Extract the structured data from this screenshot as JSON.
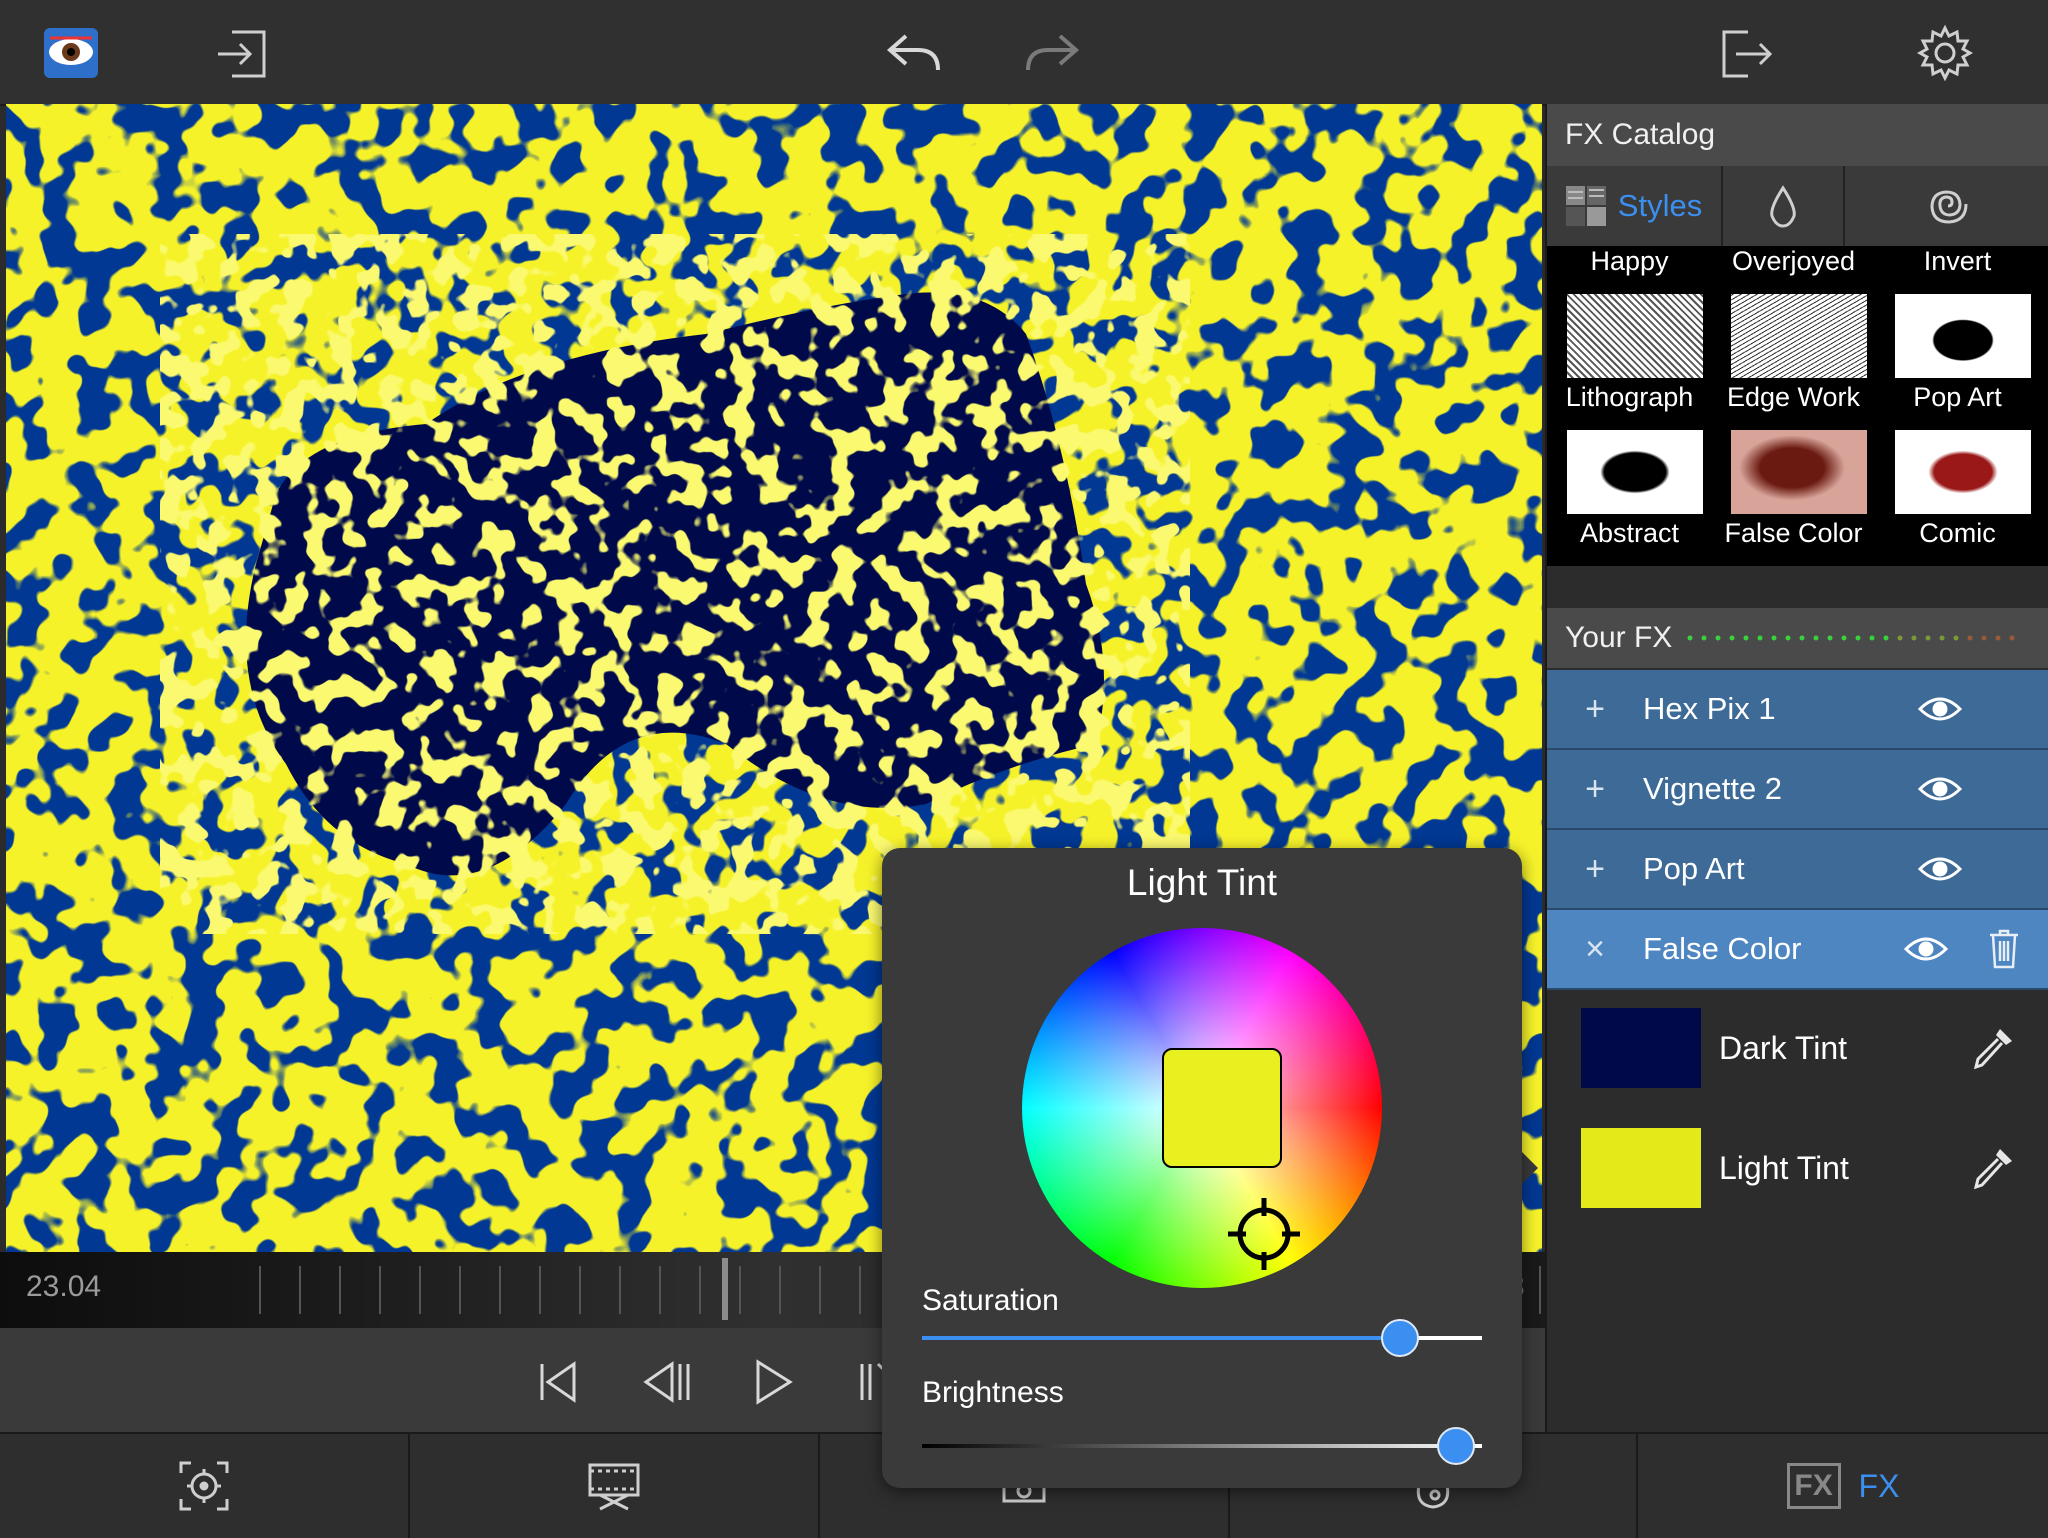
{
  "toolbar": {
    "app_icon": "eye-logo-icon",
    "import_icon": "import-icon",
    "undo_icon": "undo-icon",
    "redo_icon": "redo-icon",
    "export_icon": "export-icon",
    "settings_icon": "gear-icon"
  },
  "timeline": {
    "time": "23.04",
    "end_partial": "3"
  },
  "transport": {
    "buttons": [
      "skip-to-start-icon",
      "step-back-icon",
      "play-icon",
      "step-forward-icon"
    ]
  },
  "fx_catalog": {
    "title": "FX Catalog",
    "tabs": [
      {
        "label": "Styles",
        "icon": "styles-grid-icon",
        "active": true
      },
      {
        "label": "",
        "icon": "drop-icon"
      },
      {
        "label": "",
        "icon": "spiral-icon"
      }
    ],
    "rows": [
      [
        "Happy",
        "Overjoyed",
        "Invert"
      ],
      [
        "Lithograph",
        "Edge Work",
        "Pop Art"
      ],
      [
        "Abstract",
        "False Color",
        "Comic"
      ]
    ]
  },
  "your_fx": {
    "title": "Your FX",
    "items": [
      {
        "name": "Hex Pix 1",
        "symbol": "+",
        "visible": true
      },
      {
        "name": "Vignette 2",
        "symbol": "+",
        "visible": true
      },
      {
        "name": "Pop Art",
        "symbol": "+",
        "visible": true
      },
      {
        "name": "False Color",
        "symbol": "×",
        "visible": true,
        "selected": true
      }
    ]
  },
  "tints": [
    {
      "name": "Dark Tint",
      "color": "#000a4a"
    },
    {
      "name": "Light Tint",
      "color": "#e2ea1a"
    }
  ],
  "popup": {
    "title": "Light Tint",
    "current_color": "#e8f020",
    "saturation_label": "Saturation",
    "saturation": 0.85,
    "brightness_label": "Brightness",
    "brightness": 0.95
  },
  "bottom_bar": {
    "items": [
      "focus-target-icon",
      "film-cut-icon",
      "person-icon",
      "palette-icon",
      "FX"
    ],
    "fx_label": "FX"
  },
  "colors": {
    "accent": "#3b8ff0",
    "preview_bg": "#f6f22a",
    "preview_blob": "#000a4a",
    "fx_row": "#3d6a96",
    "fx_row_selected": "#4e86c2"
  }
}
